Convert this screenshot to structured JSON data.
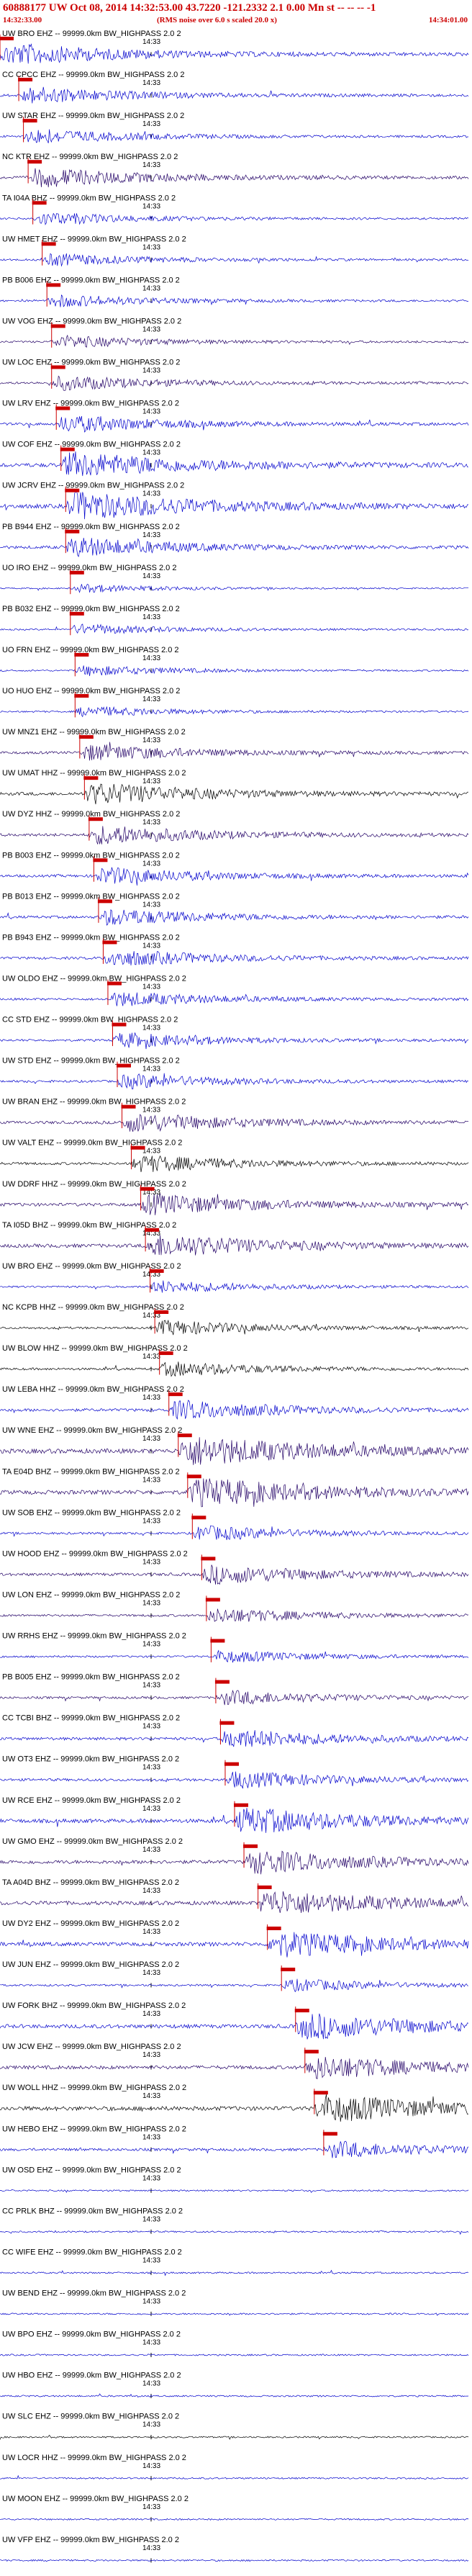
{
  "header": {
    "title": "60888177 UW Oct 08, 2014 14:32:53.00   43.7220 -121.2332   2.1 0.00 Mn st -- -- -- -1",
    "start_time": "14:32:33.00",
    "note": "(RMS noise over 6.0 s scaled 20.0 x)",
    "end_time": "14:34:01.00"
  },
  "chart_data": {
    "type": "seismogram",
    "time_range": [
      "14:32:33.00",
      "14:34:01.00"
    ],
    "tick_label": "14:33",
    "traces": [
      {
        "label": "UW BRO EHZ -- 99999.0km BW_HIGHPASS  2.0  2",
        "color": "#0000cc",
        "pick": 0.0,
        "amp": 1.0
      },
      {
        "label": "CC CPCC EHZ -- 99999.0km BW_HIGHPASS  2.0  2",
        "color": "#0000cc",
        "pick": 0.04,
        "amp": 0.8
      },
      {
        "label": "UW STAR EHZ -- 99999.0km BW_HIGHPASS  2.0  2",
        "color": "#0000cc",
        "pick": 0.05,
        "amp": 0.7
      },
      {
        "label": "NC KTR EHZ -- 99999.0km BW_HIGHPASS  2.0  2",
        "color": "#220066",
        "pick": 0.06,
        "amp": 0.9
      },
      {
        "label": "TA I04A BHZ -- 99999.0km BW_HIGHPASS  2.0  2",
        "color": "#0000cc",
        "pick": 0.07,
        "amp": 0.6
      },
      {
        "label": "UW HMET EHZ -- 99999.0km BW_HIGHPASS  2.0  2",
        "color": "#0000cc",
        "pick": 0.09,
        "amp": 0.6
      },
      {
        "label": "PB B006 EHZ -- 99999.0km BW_HIGHPASS  2.0  2",
        "color": "#0000cc",
        "pick": 0.1,
        "amp": 0.6
      },
      {
        "label": "UW VOG EHZ -- 99999.0km BW_HIGHPASS  2.0  2",
        "color": "#220066",
        "pick": 0.11,
        "amp": 0.6
      },
      {
        "label": "UW LOC EHZ -- 99999.0km BW_HIGHPASS  2.0  2",
        "color": "#220066",
        "pick": 0.11,
        "amp": 0.7
      },
      {
        "label": "UW LRV EHZ -- 99999.0km BW_HIGHPASS  2.0  2",
        "color": "#0000cc",
        "pick": 0.12,
        "amp": 0.8
      },
      {
        "label": "UW COF EHZ -- 99999.0km BW_HIGHPASS  2.0  2",
        "color": "#0000cc",
        "pick": 0.13,
        "amp": 1.2
      },
      {
        "label": "UW JCRV EHZ -- 99999.0km BW_HIGHPASS  2.0  2",
        "color": "#0000cc",
        "pick": 0.14,
        "amp": 1.3
      },
      {
        "label": "PB B944 EHZ -- 99999.0km BW_HIGHPASS  2.0  2",
        "color": "#0000cc",
        "pick": 0.14,
        "amp": 0.9
      },
      {
        "label": "UO IRO EHZ -- 99999.0km BW_HIGHPASS  2.0  2",
        "color": "#0000cc",
        "pick": 0.15,
        "amp": 0.4
      },
      {
        "label": "PB B032 EHZ -- 99999.0km BW_HIGHPASS  2.0  2",
        "color": "#0000cc",
        "pick": 0.15,
        "amp": 0.5
      },
      {
        "label": "UO FRN EHZ -- 99999.0km BW_HIGHPASS  2.0  2",
        "color": "#0000cc",
        "pick": 0.16,
        "amp": 0.5
      },
      {
        "label": "UO HUO EHZ -- 99999.0km BW_HIGHPASS  2.0  2",
        "color": "#0000cc",
        "pick": 0.16,
        "amp": 0.5
      },
      {
        "label": "UW MNZ1 EHZ -- 99999.0km BW_HIGHPASS  2.0  2",
        "color": "#220066",
        "pick": 0.17,
        "amp": 0.8
      },
      {
        "label": "UW UMAT HHZ -- 99999.0km BW_HIGHPASS  2.0  2",
        "color": "#000000",
        "pick": 0.18,
        "amp": 1.0
      },
      {
        "label": "UW DYZ HHZ -- 99999.0km BW_HIGHPASS  2.0  2",
        "color": "#220066",
        "pick": 0.19,
        "amp": 0.9
      },
      {
        "label": "PB B003 EHZ -- 99999.0km BW_HIGHPASS  2.0  2",
        "color": "#0000cc",
        "pick": 0.2,
        "amp": 0.8
      },
      {
        "label": "PB B013 EHZ -- 99999.0km BW_HIGHPASS  2.0  2",
        "color": "#0000cc",
        "pick": 0.21,
        "amp": 0.8
      },
      {
        "label": "PB B943 EHZ -- 99999.0km BW_HIGHPASS  2.0  2",
        "color": "#0000cc",
        "pick": 0.22,
        "amp": 0.8
      },
      {
        "label": "UW OLDO EHZ -- 99999.0km BW_HIGHPASS  2.0  2",
        "color": "#0000cc",
        "pick": 0.23,
        "amp": 0.7
      },
      {
        "label": "CC STD EHZ -- 99999.0km BW_HIGHPASS  2.0  2",
        "color": "#0000cc",
        "pick": 0.24,
        "amp": 0.7
      },
      {
        "label": "UW STD EHZ -- 99999.0km BW_HIGHPASS  2.0  2",
        "color": "#0000cc",
        "pick": 0.25,
        "amp": 0.7
      },
      {
        "label": "UW BRAN EHZ -- 99999.0km BW_HIGHPASS  2.0  2",
        "color": "#220066",
        "pick": 0.26,
        "amp": 0.9
      },
      {
        "label": "UW VALT EHZ -- 99999.0km BW_HIGHPASS  2.0  2",
        "color": "#000000",
        "pick": 0.28,
        "amp": 0.8
      },
      {
        "label": "UW DDRF HHZ -- 99999.0km BW_HIGHPASS  2.0  2",
        "color": "#220066",
        "pick": 0.3,
        "amp": 1.0
      },
      {
        "label": "TA I05D BHZ -- 99999.0km BW_HIGHPASS  2.0  2",
        "color": "#220066",
        "pick": 0.31,
        "amp": 1.1
      },
      {
        "label": "UW BRO EHZ -- 99999.0km BW_HIGHPASS  2.0  2",
        "color": "#0000cc",
        "pick": 0.32,
        "amp": 0.6
      },
      {
        "label": "NC KCPB HHZ -- 99999.0km BW_HIGHPASS  2.0  2",
        "color": "#000000",
        "pick": 0.33,
        "amp": 0.7
      },
      {
        "label": "UW BLOW HHZ -- 99999.0km BW_HIGHPASS  2.0  2",
        "color": "#000000",
        "pick": 0.34,
        "amp": 0.7
      },
      {
        "label": "UW LEBA HHZ -- 99999.0km BW_HIGHPASS  2.0  2",
        "color": "#0000cc",
        "pick": 0.36,
        "amp": 0.9
      },
      {
        "label": "UW WNE EHZ -- 99999.0km BW_HIGHPASS  2.0  2",
        "color": "#220066",
        "pick": 0.38,
        "amp": 1.4
      },
      {
        "label": "TA E04D BHZ -- 99999.0km BW_HIGHPASS  2.0  2",
        "color": "#220066",
        "pick": 0.4,
        "amp": 1.3
      },
      {
        "label": "UW SOB EHZ -- 99999.0km BW_HIGHPASS  2.0  2",
        "color": "#0000cc",
        "pick": 0.41,
        "amp": 0.7
      },
      {
        "label": "UW HOOD EHZ -- 99999.0km BW_HIGHPASS  2.0  2",
        "color": "#220066",
        "pick": 0.43,
        "amp": 0.9
      },
      {
        "label": "UW LON EHZ -- 99999.0km BW_HIGHPASS  2.0  2",
        "color": "#220066",
        "pick": 0.44,
        "amp": 0.7
      },
      {
        "label": "UW RRHS EHZ -- 99999.0km BW_HIGHPASS  2.0  2",
        "color": "#0000cc",
        "pick": 0.45,
        "amp": 0.6
      },
      {
        "label": "PB B005 EHZ -- 99999.0km BW_HIGHPASS  2.0  2",
        "color": "#220066",
        "pick": 0.46,
        "amp": 0.7
      },
      {
        "label": "CC TCBI BHZ -- 99999.0km BW_HIGHPASS  2.0  2",
        "color": "#0000cc",
        "pick": 0.47,
        "amp": 0.9
      },
      {
        "label": "UW OT3 EHZ -- 99999.0km BW_HIGHPASS  2.0  2",
        "color": "#0000cc",
        "pick": 0.48,
        "amp": 0.8
      },
      {
        "label": "UW RCE EHZ -- 99999.0km BW_HIGHPASS  2.0  2",
        "color": "#0000cc",
        "pick": 0.5,
        "amp": 1.2
      },
      {
        "label": "UW GMO EHZ -- 99999.0km BW_HIGHPASS  2.0  2",
        "color": "#220066",
        "pick": 0.52,
        "amp": 1.1
      },
      {
        "label": "TA A04D BHZ -- 99999.0km BW_HIGHPASS  2.0  2",
        "color": "#220066",
        "pick": 0.55,
        "amp": 1.2
      },
      {
        "label": "UW DY2 EHZ -- 99999.0km BW_HIGHPASS  2.0  2",
        "color": "#0000cc",
        "pick": 0.57,
        "amp": 1.2
      },
      {
        "label": "UW JUN EHZ -- 99999.0km BW_HIGHPASS  2.0  2",
        "color": "#0000cc",
        "pick": 0.6,
        "amp": 0.6
      },
      {
        "label": "UW FORK BHZ -- 99999.0km BW_HIGHPASS  2.0  2",
        "color": "#0000cc",
        "pick": 0.63,
        "amp": 1.2
      },
      {
        "label": "UW JCW EHZ -- 99999.0km BW_HIGHPASS  2.0  2",
        "color": "#220066",
        "pick": 0.65,
        "amp": 1.1
      },
      {
        "label": "UW WOLL HHZ -- 99999.0km BW_HIGHPASS  2.0  2",
        "color": "#000000",
        "pick": 0.67,
        "amp": 1.3
      },
      {
        "label": "UW HEBO EHZ -- 99999.0km BW_HIGHPASS  2.0  2",
        "color": "#0000cc",
        "pick": 0.69,
        "amp": 0.8
      },
      {
        "label": "UW OSD EHZ -- 99999.0km BW_HIGHPASS  2.0  2",
        "color": "#0000cc",
        "pick": null,
        "amp": 0.5
      },
      {
        "label": "CC PRLK BHZ -- 99999.0km BW_HIGHPASS  2.0  2",
        "color": "#0000cc",
        "pick": null,
        "amp": 0.5
      },
      {
        "label": "CC WIFE EHZ -- 99999.0km BW_HIGHPASS  2.0  2",
        "color": "#0000cc",
        "pick": null,
        "amp": 0.5
      },
      {
        "label": "UW BEND EHZ -- 99999.0km BW_HIGHPASS  2.0  2",
        "color": "#0000cc",
        "pick": null,
        "amp": 0.5
      },
      {
        "label": "UW BPO EHZ -- 99999.0km BW_HIGHPASS  2.0  2",
        "color": "#0000cc",
        "pick": null,
        "amp": 0.5
      },
      {
        "label": "UW HBO EHZ -- 99999.0km BW_HIGHPASS  2.0  2",
        "color": "#0000cc",
        "pick": null,
        "amp": 0.5
      },
      {
        "label": "UW SLC EHZ -- 99999.0km BW_HIGHPASS  2.0  2",
        "color": "#000000",
        "pick": null,
        "amp": 0.5
      },
      {
        "label": "UW LOCR HHZ -- 99999.0km BW_HIGHPASS  2.0  2",
        "color": "#0000cc",
        "pick": null,
        "amp": 0.5
      },
      {
        "label": "UW MOON EHZ -- 99999.0km BW_HIGHPASS  2.0  2",
        "color": "#0000cc",
        "pick": null,
        "amp": 0.5
      },
      {
        "label": "UW VFP EHZ -- 99999.0km BW_HIGHPASS  2.0  2",
        "color": "#0000cc",
        "pick": null,
        "amp": 0.5
      }
    ],
    "pick_color": "#cc0000"
  }
}
